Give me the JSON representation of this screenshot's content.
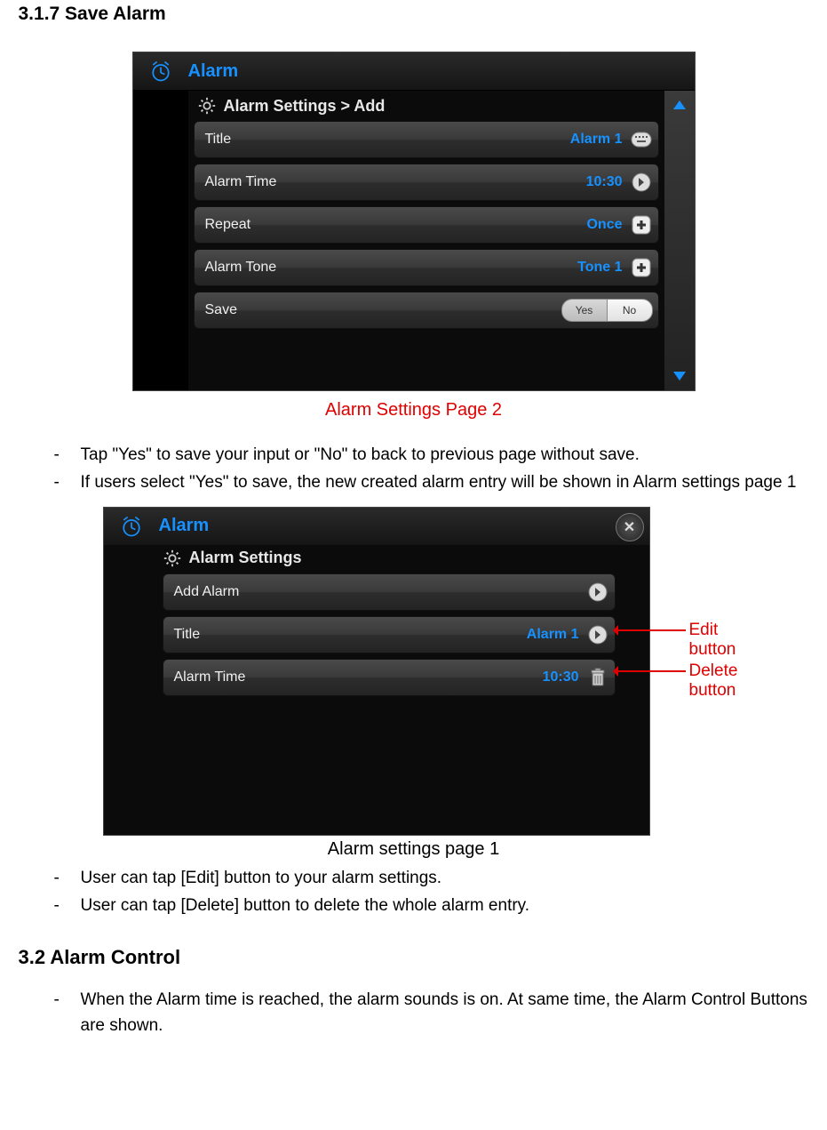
{
  "headings": {
    "h_317": "3.1.7 Save Alarm",
    "h_32": "3.2 Alarm Control"
  },
  "captions": {
    "page2": "Alarm Settings Page 2",
    "page1": "Alarm settings page 1"
  },
  "bullets_a": [
    "Tap \"Yes\" to save your input or \"No\" to back to previous page without save.",
    "If users select \"Yes\" to save, the new created alarm entry will be shown in Alarm settings page 1"
  ],
  "bullets_b": [
    "User can tap [Edit] button to your alarm settings.",
    "User can tap [Delete] button to delete the whole alarm entry."
  ],
  "bullets_c": [
    "When the Alarm time is reached, the alarm sounds is on. At same time, the Alarm Control Buttons are shown."
  ],
  "callouts": {
    "edit": "Edit button",
    "delete": "Delete button"
  },
  "shot1": {
    "title": "Alarm",
    "breadcrumb": "Alarm Settings > Add",
    "rows": {
      "title_label": "Title",
      "title_value": "Alarm 1",
      "time_label": "Alarm Time",
      "time_value": "10:30",
      "repeat_label": "Repeat",
      "repeat_value": "Once",
      "tone_label": "Alarm Tone",
      "tone_value": "Tone 1",
      "save_label": "Save",
      "yes": "Yes",
      "no": "No"
    }
  },
  "shot2": {
    "title": "Alarm",
    "subhead": "Alarm Settings",
    "rows": {
      "add_label": "Add Alarm",
      "title_label": "Title",
      "title_value": "Alarm 1",
      "time_label": "Alarm Time",
      "time_value": "10:30"
    }
  }
}
